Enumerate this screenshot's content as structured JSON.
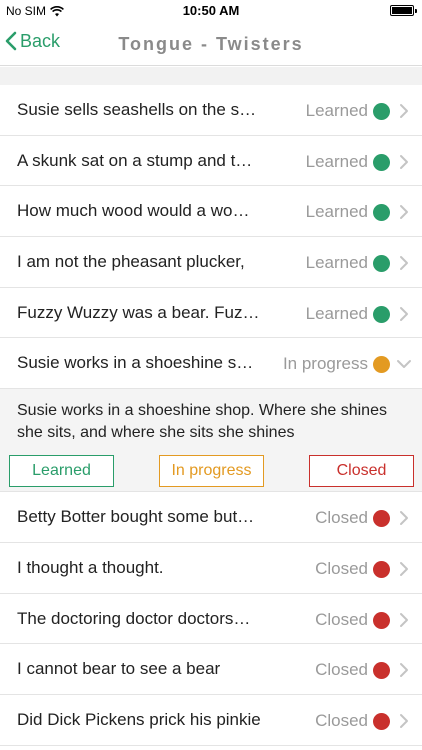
{
  "status_bar": {
    "carrier": "No SIM",
    "time": "10:50 AM"
  },
  "nav": {
    "back_label": "Back",
    "title": "Tongue - Twisters"
  },
  "colors": {
    "learned": "#2a9d6a",
    "in_progress": "#e39a22",
    "closed": "#c9302c",
    "chevron": "#c4c4c4"
  },
  "rows_before": [
    {
      "title": "Susie sells seashells on the s…",
      "status": "Learned",
      "state": "learned"
    },
    {
      "title": "A skunk sat on a stump and t…",
      "status": "Learned",
      "state": "learned"
    },
    {
      "title": "How much wood would a wo…",
      "status": "Learned",
      "state": "learned"
    },
    {
      "title": "I am not the pheasant plucker,",
      "status": "Learned",
      "state": "learned"
    },
    {
      "title": "Fuzzy Wuzzy was a bear. Fuz…",
      "status": "Learned",
      "state": "learned"
    }
  ],
  "expanded_row": {
    "title": "Susie works in a shoeshine s…",
    "status": "In progress",
    "state": "in_progress",
    "full_text": "Susie works in a shoeshine shop. Where she shines she sits, and where she sits she shines",
    "buttons": {
      "learned": "Learned",
      "in_progress": "In progress",
      "closed": "Closed"
    }
  },
  "rows_after": [
    {
      "title": "Betty Botter bought some but…",
      "status": "Closed",
      "state": "closed"
    },
    {
      "title": "I thought a thought.",
      "status": "Closed",
      "state": "closed"
    },
    {
      "title": "The doctoring doctor doctors…",
      "status": "Closed",
      "state": "closed"
    },
    {
      "title": "I cannot bear to see a bear",
      "status": "Closed",
      "state": "closed"
    },
    {
      "title": "Did Dick Pickens prick his pinkie",
      "status": "Closed",
      "state": "closed"
    }
  ]
}
